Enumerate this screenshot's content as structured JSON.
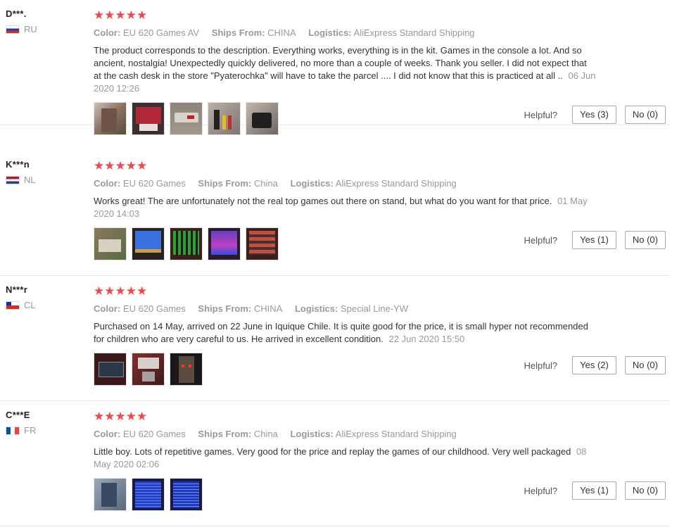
{
  "reviews": [
    {
      "user": "D***.",
      "country": "RU",
      "flag": [
        "#ffffff",
        "#1c3fa8",
        "#d52b1e"
      ],
      "stars": "★★★★★",
      "color_label": "Color:",
      "color_value": "EU 620 Games AV",
      "ships_label": "Ships From:",
      "ships_value": "CHINA",
      "logistics_label": "Logistics:",
      "logistics_value": "AliExpress Standard Shipping",
      "text": "The product corresponds to the description. Everything works, everything is in the kit. Games in the console a lot. And so ancient, nostalgia! Unexpectedly quickly delivered, no more than a couple of weeks. Thank you seller. I did not expect that at the cash desk in the store \"Pyaterochka\" will have to take the parcel .... I did not know that this is practiced at all ..",
      "date": "06 Jun 2020 12:26",
      "photos": [
        "photo-parcel",
        "photo-console-screen",
        "photo-controller",
        "photo-cables",
        "photo-adapter"
      ],
      "helpful_label": "Helpful?",
      "yes": "Yes (3)",
      "no": "No (0)"
    },
    {
      "user": "K***n",
      "country": "NL",
      "flag": [
        "#ae1c28",
        "#ffffff",
        "#21468b"
      ],
      "stars": "★★★★★",
      "color_label": "Color:",
      "color_value": "EU 620 Games",
      "ships_label": "Ships From:",
      "ships_value": "China",
      "logistics_label": "Logistics:",
      "logistics_value": "AliExpress Standard Shipping",
      "text": "Works great! The are unfortunately not the real top games out there on stand, but what do you want for that price.",
      "date": "01 May 2020 14:03",
      "photos": [
        "photo-console",
        "photo-game-blue",
        "photo-game-green",
        "photo-game-purple",
        "photo-game-brick"
      ],
      "helpful_label": "Helpful?",
      "yes": "Yes (1)",
      "no": "No (0)"
    },
    {
      "user": "N***r",
      "country": "CL",
      "flag": [
        "#ffffff",
        "#d52b1e",
        "#0039a6"
      ],
      "stars": "★★★★★",
      "color_label": "Color:",
      "color_value": "EU 620 Games",
      "ships_label": "Ships From:",
      "ships_value": "CHINA",
      "logistics_label": "Logistics:",
      "logistics_value": "Special Line-YW",
      "text": "Purchased on 14 May, arrived on 22 June in Iquique Chile. It is quite good for the price, it is small hyper not recommended for children who are very careful to us. He arrived in excellent condition.",
      "date": "22 Jun 2020 15:50",
      "photos": [
        "photo-tv-screen",
        "photo-box",
        "photo-controller-dark"
      ],
      "helpful_label": "Helpful?",
      "yes": "Yes (2)",
      "no": "No (0)"
    },
    {
      "user": "C***E",
      "country": "FR",
      "flag": [
        "#0055a4",
        "#ffffff",
        "#ef4135"
      ],
      "stars": "★★★★★",
      "color_label": "Color:",
      "color_value": "EU 620 Games",
      "ships_label": "Ships From:",
      "ships_value": "China",
      "logistics_label": "Logistics:",
      "logistics_value": "AliExpress Standard Shipping",
      "text": "Little boy. Lots of repetitive games. Very good for the price and replay the games of our childhood. Very well packaged",
      "date": "08 May 2020 02:06",
      "photos": [
        "photo-child-console",
        "photo-game-list",
        "photo-game-list-2"
      ],
      "helpful_label": "Helpful?",
      "yes": "Yes (1)",
      "no": "No (0)"
    }
  ]
}
